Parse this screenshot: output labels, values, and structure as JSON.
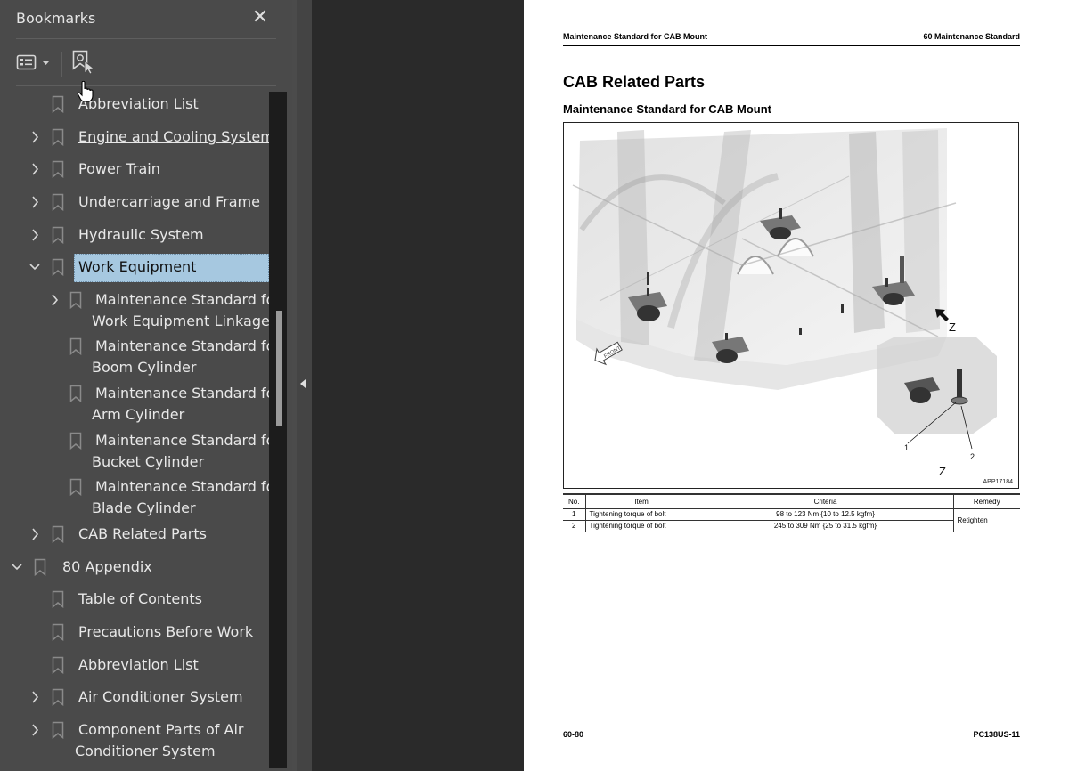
{
  "sidebar": {
    "title": "Bookmarks",
    "close_icon": "close-icon",
    "toolbar": {
      "options_icon": "list-options-icon",
      "options_dropdown_icon": "caret-down-icon",
      "find_bookmark_icon": "find-current-bookmark-icon"
    },
    "items": [
      {
        "label": "Abbreviation List",
        "level": 1,
        "expander": "none"
      },
      {
        "label": "Engine and Cooling System",
        "level": 1,
        "expander": "collapsed",
        "hovered": true
      },
      {
        "label": "Power Train",
        "level": 1,
        "expander": "collapsed"
      },
      {
        "label": "Undercarriage and Frame",
        "level": 1,
        "expander": "collapsed"
      },
      {
        "label": "Hydraulic System",
        "level": 1,
        "expander": "collapsed"
      },
      {
        "label": "Work Equipment",
        "level": 1,
        "expander": "expanded",
        "selected": true
      },
      {
        "label": "Maintenance Standard for",
        "label2": "Work Equipment Linkage",
        "level": 2,
        "expander": "collapsed"
      },
      {
        "label": "Maintenance Standard for",
        "label2": "Boom Cylinder",
        "level": 2,
        "expander": "none"
      },
      {
        "label": "Maintenance Standard for",
        "label2": "Arm Cylinder",
        "level": 2,
        "expander": "none"
      },
      {
        "label": "Maintenance Standard for",
        "label2": "Bucket Cylinder",
        "level": 2,
        "expander": "none"
      },
      {
        "label": "Maintenance Standard for",
        "label2": "Blade Cylinder",
        "level": 2,
        "expander": "none"
      },
      {
        "label": "CAB Related Parts",
        "level": 1,
        "expander": "collapsed"
      },
      {
        "label": "80 Appendix",
        "level": 0,
        "expander": "expanded"
      },
      {
        "label": "Table of Contents",
        "level": 1,
        "expander": "none"
      },
      {
        "label": "Precautions Before Work",
        "level": 1,
        "expander": "none"
      },
      {
        "label": "Abbreviation List",
        "level": 1,
        "expander": "none"
      },
      {
        "label": "Air Conditioner System",
        "level": 1,
        "expander": "collapsed"
      },
      {
        "label": "Component Parts of Air",
        "label2": "Conditioner System",
        "level": 1,
        "expander": "collapsed"
      }
    ],
    "scroll_position_fraction": 0.32,
    "collapse_panel_icon": "triangle-left-icon"
  },
  "page": {
    "header_left": "Maintenance Standard for CAB Mount",
    "header_right": "60 Maintenance Standard",
    "title": "CAB Related Parts",
    "subtitle": "Maintenance Standard for CAB Mount",
    "figure": {
      "callouts": [
        "Z",
        "Z",
        "1",
        "2"
      ],
      "front_label": "FRONT",
      "figure_id": "APP17184"
    },
    "table": {
      "headers": [
        "No.",
        "Item",
        "Criteria",
        "Remedy"
      ],
      "rows": [
        {
          "no": "1",
          "item": "Tightening torque of bolt",
          "criteria": "98 to 123 Nm {10 to 12.5 kgfm}"
        },
        {
          "no": "2",
          "item": "Tightening torque of bolt",
          "criteria": "245 to 309 Nm {25 to 31.5 kgfm}"
        }
      ],
      "remedy": "Retighten"
    },
    "footer_left": "60-80",
    "footer_right": "PC138US-11"
  }
}
